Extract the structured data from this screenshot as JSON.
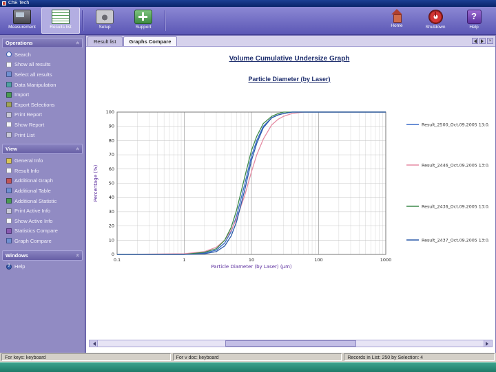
{
  "window": {
    "title": "ChE Tech"
  },
  "toolbar": {
    "left": [
      {
        "label": "Measurement",
        "icon": "measurement-icon",
        "selected": false
      },
      {
        "label": "Results list",
        "icon": "results-list-icon",
        "selected": true
      },
      {
        "label": "Setup",
        "icon": "setup-icon",
        "selected": false
      },
      {
        "label": "Support",
        "icon": "support-icon",
        "selected": false
      }
    ],
    "right": [
      {
        "label": "Home",
        "icon": "home-icon"
      },
      {
        "label": "Shutdown",
        "icon": "shutdown-icon"
      },
      {
        "label": "Help",
        "icon": "help-icon"
      }
    ]
  },
  "sidebar": {
    "sections": [
      {
        "title": "Operations",
        "items": [
          "Search",
          "Show all results",
          "Select all results",
          "Data Manipulation",
          "Import",
          "Export Selections",
          "Print Report",
          "Show Report",
          "Print List"
        ],
        "icons": [
          "search-icon",
          "show-all-results-icon",
          "select-all-results-icon",
          "data-manipulation-icon",
          "import-icon",
          "export-selections-icon",
          "print-report-icon",
          "show-report-icon",
          "print-list-icon"
        ]
      },
      {
        "title": "View",
        "items": [
          "General Info",
          "Result Info",
          "Additional Graph",
          "Additional Table",
          "Additional Statistic",
          "Print Active Info",
          "Show Active Info",
          "Statistics Compare",
          "Graph Compare"
        ],
        "icons": [
          "general-info-icon",
          "result-info-icon",
          "additional-graph-icon",
          "additional-table-icon",
          "additional-statistic-icon",
          "print-active-info-icon",
          "show-active-info-icon",
          "statistics-compare-icon",
          "graph-compare-icon"
        ]
      },
      {
        "title": "Windows",
        "items": [
          "Help"
        ],
        "icons": [
          "help-question-icon"
        ]
      }
    ]
  },
  "tabs": {
    "items": [
      "Result list",
      "Graphs Compare"
    ],
    "active": 1
  },
  "chart_data": {
    "type": "line",
    "title": "Volume Cumulative Undersize Graph",
    "subtitle": "Particle Diameter (by Laser)",
    "xlabel": "Particle Diameter (by Laser) (µm)",
    "ylabel": "Percentage (%)",
    "x_scale": "log",
    "xlim": [
      0.1,
      1000
    ],
    "ylim": [
      0,
      100
    ],
    "x_ticks": [
      0.1,
      1,
      10,
      100,
      1000
    ],
    "y_ticks": [
      0,
      10,
      20,
      30,
      40,
      50,
      60,
      70,
      80,
      90,
      100
    ],
    "grid": true,
    "legend_position": "right",
    "x": [
      0.1,
      1,
      2,
      3,
      4,
      5,
      6,
      8,
      10,
      12,
      15,
      20,
      25,
      30,
      40,
      60,
      100,
      1000
    ],
    "series": [
      {
        "name": "Result_2500_Oct.09.2005 13:0...",
        "color": "#3a6cc8",
        "values": [
          0,
          0,
          1,
          3,
          8,
          16,
          27,
          50,
          69,
          80,
          90,
          96,
          98,
          99,
          100,
          100,
          100,
          100
        ]
      },
      {
        "name": "Result_2446_Oct.09.2005 13:0...",
        "color": "#e58ca4",
        "values": [
          0,
          0.5,
          2,
          5,
          10,
          17,
          25,
          42,
          58,
          70,
          81,
          91,
          95,
          97,
          99,
          100,
          100,
          100
        ]
      },
      {
        "name": "Result_2436_Oct.09.2005 13:0...",
        "color": "#3d8a4a",
        "values": [
          0,
          0,
          1.5,
          4,
          10,
          19,
          31,
          55,
          73,
          83,
          92,
          97,
          99,
          100,
          100,
          100,
          100,
          100
        ]
      },
      {
        "name": "Result_2437_Oct.09.2005 13:0...",
        "color": "#2a5aa8",
        "values": [
          0,
          0,
          0.5,
          2,
          6,
          13,
          23,
          46,
          66,
          78,
          89,
          96,
          98,
          99,
          100,
          100,
          100,
          100
        ]
      }
    ]
  },
  "status_bar": {
    "left": "For keys: keyboard",
    "middle": "For v doc: keyboard",
    "right": "Records in List: 250 by Selection: 4"
  }
}
